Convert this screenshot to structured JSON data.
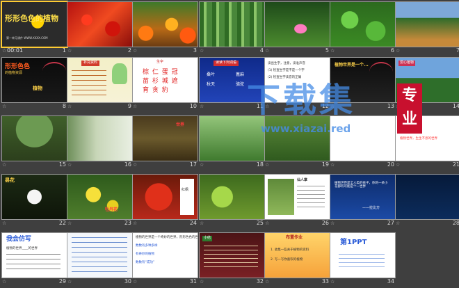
{
  "sorter": {
    "time_label": "00:01",
    "slides": [
      {
        "n": "1",
        "title": "形形色色的植物",
        "caption": "第一单元课件 WWW.XXXX.COM"
      },
      {
        "n": "2"
      },
      {
        "n": "3"
      },
      {
        "n": "4"
      },
      {
        "n": "5"
      },
      {
        "n": "6"
      },
      {
        "n": "7"
      },
      {
        "n": "8",
        "title": "形形色色",
        "sub": "的植物资源",
        "label": "植物"
      },
      {
        "n": "9",
        "tag": "补充资料"
      },
      {
        "n": "10",
        "tag": "生字",
        "chars": [
          "棕 仁 蛋 冠",
          "苗 杉 城 遮",
          "育 贪 豹"
        ]
      },
      {
        "n": "11",
        "tag": "读读下列词语",
        "words": [
          "桑叶",
          "蓖麻",
          "秋天",
          "骆驼"
        ]
      },
      {
        "n": "12",
        "lines": [
          "读出生字，注意，读准声音",
          "(1) 检查生字是不是一个字",
          "(2) 检查生字读音的正确"
        ]
      },
      {
        "n": "13",
        "title": "植物世界是一个..."
      },
      {
        "n": "14",
        "title": "爱心植物"
      },
      {
        "n": "15"
      },
      {
        "n": "16"
      },
      {
        "n": "17",
        "label": "世界"
      },
      {
        "n": "18"
      },
      {
        "n": "19"
      },
      {
        "n": "20"
      },
      {
        "n": "21",
        "caption": "植物世界，生生不息的世界"
      },
      {
        "n": "22",
        "label": "昙花"
      },
      {
        "n": "23",
        "label": "牡丹花"
      },
      {
        "n": "24",
        "label": "红枫"
      },
      {
        "n": "25"
      },
      {
        "n": "26",
        "label": "仙人掌"
      },
      {
        "n": "27",
        "quote": "植物世界是全人类的孩子，你的一朵小花都有可能是个一世界",
        "author": "——拉比方"
      },
      {
        "n": "28"
      },
      {
        "n": "29",
        "title": "我会仿写",
        "line": "植物的世界____的世界"
      },
      {
        "n": "30"
      },
      {
        "n": "31",
        "lines": [
          "植物的世界是一个奇妙的世界，形形色色的世界",
          "数数有多种多样",
          "有奇妙的植物",
          "数数有“成功”"
        ]
      },
      {
        "n": "32",
        "tag": "小结"
      },
      {
        "n": "33",
        "title": "布置作业",
        "lines": [
          "1. 收集一些关于植物的资料",
          "2. 写一写你喜欢的植物"
        ]
      },
      {
        "n": "34",
        "title": "第1PPT"
      }
    ]
  },
  "watermark": {
    "big": "下载集",
    "url": "www.xiazai.red",
    "badge": "专业"
  },
  "colors": {
    "background": "#3f3f3f",
    "selection": "#ffcc33",
    "number_text": "#d8d8d8",
    "watermark": "#468ce6"
  }
}
